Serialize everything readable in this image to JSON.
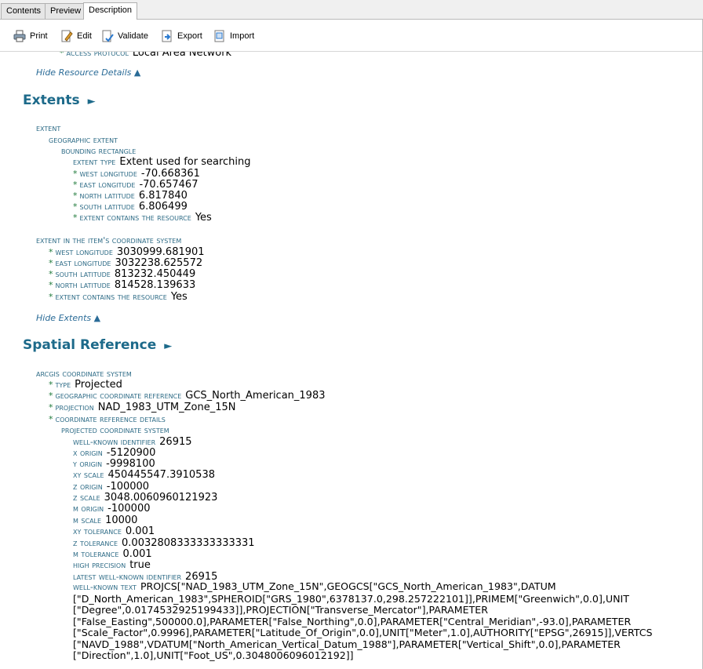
{
  "tabs": [
    "Contents",
    "Preview",
    "Description"
  ],
  "toolbar": {
    "print": "Print",
    "edit": "Edit",
    "validate": "Validate",
    "export": "Export",
    "import": "Import"
  },
  "top_cut": {
    "label": "Access protocol",
    "value": "Local Area Network"
  },
  "hide_resource": "Hide Resource Details ▲",
  "extents": {
    "title": "Extents",
    "arrow": "►",
    "extent_label": "Extent",
    "geo_label": "Geographic extent",
    "bbox_label": "Bounding rectangle",
    "extent_type_label": "Extent type",
    "extent_type_value": "Extent used for searching",
    "west_label": "West longitude",
    "west_value": "-70.668361",
    "east_label": "East longitude",
    "east_value": "-70.657467",
    "north_label": "North latitude",
    "north_value": "6.817840",
    "south_label": "South latitude",
    "south_value": "6.806499",
    "contains_label": "Extent contains the resource",
    "contains_value": "Yes",
    "item_label": "Extent in the item's coordinate system",
    "i_west_label": "West longitude",
    "i_west_value": "3030999.681901",
    "i_east_label": "East longitude",
    "i_east_value": "3032238.625572",
    "i_south_label": "South latitude",
    "i_south_value": "813232.450449",
    "i_north_label": "North latitude",
    "i_north_value": "814528.139633",
    "i_contains_label": "Extent contains the resource",
    "i_contains_value": "Yes",
    "hide": "Hide Extents ▲"
  },
  "spatial": {
    "title": "Spatial Reference",
    "arrow": "►",
    "arcgis_label": "ArcGIS coordinate system",
    "type_label": "Type",
    "type_value": "Projected",
    "geo_ref_label": "Geographic coordinate reference",
    "geo_ref_value": "GCS_North_American_1983",
    "projection_label": "Projection",
    "projection_value": "NAD_1983_UTM_Zone_15N",
    "coord_details_label": "Coordinate reference details",
    "projected_label": "Projected coordinate system",
    "wkid_label": "Well-known identifier",
    "wkid_value": "26915",
    "xorigin_label": "X origin",
    "xorigin_value": "-5120900",
    "yorigin_label": "Y origin",
    "yorigin_value": "-9998100",
    "xyscale_label": "XY scale",
    "xyscale_value": "450445547.3910538",
    "zorigin_label": "Z origin",
    "zorigin_value": "-100000",
    "zscale_label": "Z scale",
    "zscale_value": "3048.0060960121923",
    "morigin_label": "M origin",
    "morigin_value": "-100000",
    "mscale_label": "M scale",
    "mscale_value": "10000",
    "xytol_label": "XY tolerance",
    "xytol_value": "0.001",
    "ztol_label": "Z tolerance",
    "ztol_value": "0.0032808333333333331",
    "mtol_label": "M tolerance",
    "mtol_value": "0.001",
    "highprec_label": "High precision",
    "highprec_value": "true",
    "latest_wkid_label": "Latest well-known identifier",
    "latest_wkid_value": "26915",
    "wkt_label": "Well-known text",
    "wkt_value": "PROJCS[\"NAD_1983_UTM_Zone_15N\",GEOGCS[\"GCS_North_American_1983\",DATUM [\"D_North_American_1983\",SPHEROID[\"GRS_1980\",6378137.0,298.257222101]],PRIMEM[\"Greenwich\",0.0],UNIT [\"Degree\",0.0174532925199433]],PROJECTION[\"Transverse_Mercator\"],PARAMETER [\"False_Easting\",500000.0],PARAMETER[\"False_Northing\",0.0],PARAMETER[\"Central_Meridian\",-93.0],PARAMETER [\"Scale_Factor\",0.9996],PARAMETER[\"Latitude_Of_Origin\",0.0],UNIT[\"Meter\",1.0],AUTHORITY[\"EPSG\",26915]],VERTCS [\"NAVD_1988\",VDATUM[\"North_American_Vertical_Datum_1988\"],PARAMETER[\"Vertical_Shift\",0.0],PARAMETER [\"Direction\",1.0],UNIT[\"Foot_US\",0.3048006096012192]]"
  }
}
